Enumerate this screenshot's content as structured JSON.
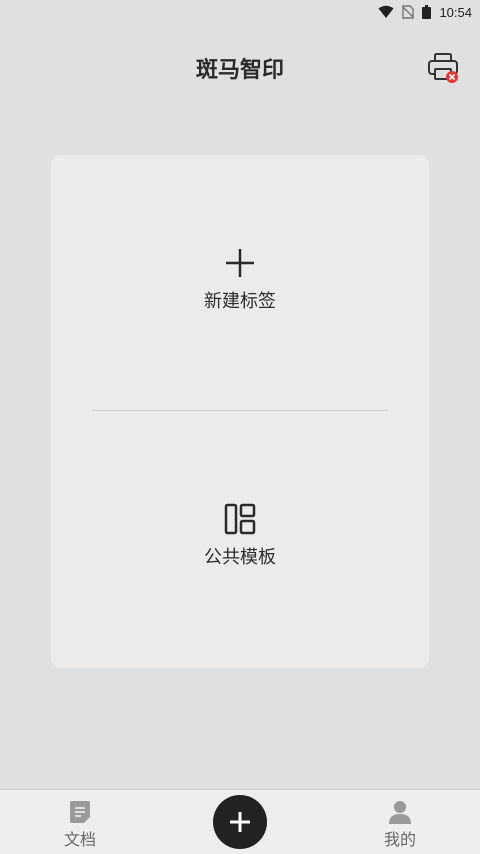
{
  "status_bar": {
    "time": "10:54",
    "icons": [
      "wifi-icon",
      "no-sim-icon",
      "battery-icon"
    ]
  },
  "header": {
    "title": "斑马智印",
    "printer_status_icon": "printer-disconnected-icon"
  },
  "main": {
    "new_label": {
      "text": "新建标签",
      "icon": "plus-icon"
    },
    "public_templates": {
      "text": "公共模板",
      "icon": "template-grid-icon"
    }
  },
  "bottom_nav": {
    "items": [
      {
        "label": "文档",
        "icon": "document-icon"
      },
      {
        "label": "我的",
        "icon": "person-icon"
      }
    ],
    "fab_icon": "plus-icon"
  },
  "colors": {
    "background": "#dfe0e2",
    "card": "#ebebeb",
    "fab": "#222222",
    "error_badge": "#e53935"
  }
}
